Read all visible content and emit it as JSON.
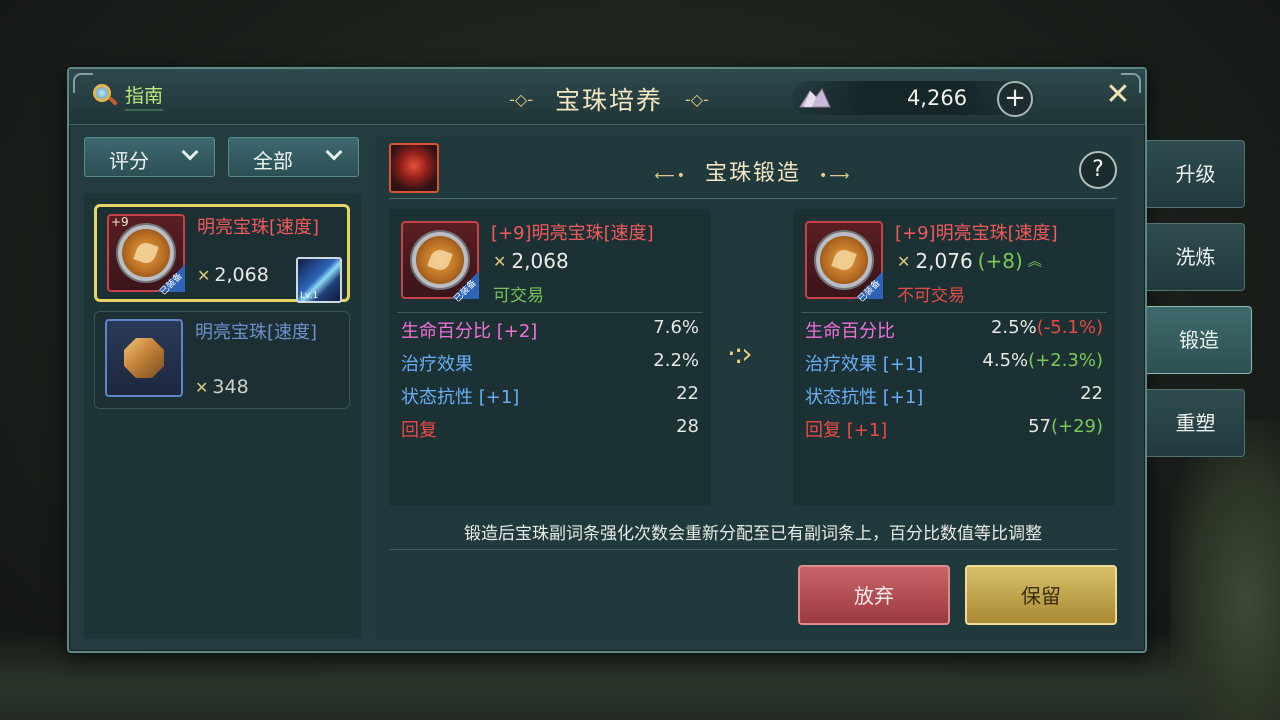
{
  "window": {
    "title": "宝珠培养",
    "guide_label": "指南"
  },
  "currency": {
    "amount": "4,266",
    "plus": "+"
  },
  "close_label": "✕",
  "filters": [
    {
      "label": "评分"
    },
    {
      "label": "全部"
    }
  ],
  "list": [
    {
      "level": "+9",
      "name": "明亮宝珠[速度]",
      "power": "2,068",
      "equip_tag": "已装备",
      "skill_lv": "Lv.1"
    },
    {
      "name": "明亮宝珠[速度]",
      "power": "348"
    }
  ],
  "forge": {
    "title": "宝珠锻造",
    "help": "?",
    "before": {
      "name": "[+9]明亮宝珠[速度]",
      "power": "2,068",
      "equip_tag": "已装备",
      "trade": "可交易",
      "stats": [
        {
          "name": "生命百分比 [+2]",
          "value": "7.6%"
        },
        {
          "name": "治疗效果",
          "value": "2.2%"
        },
        {
          "name": "状态抗性 [+1]",
          "value": "22"
        },
        {
          "name": "回复",
          "value": "28"
        }
      ]
    },
    "after": {
      "name": "[+9]明亮宝珠[速度]",
      "power": "2,076",
      "power_delta": "(+8)",
      "equip_tag": "已装备",
      "trade": "不可交易",
      "stats": [
        {
          "name": "生命百分比",
          "value": "2.5%",
          "delta": "(-5.1%)"
        },
        {
          "name": "治疗效果 [+1]",
          "value": "4.5%",
          "delta": "(+2.3%)"
        },
        {
          "name": "状态抗性 [+1]",
          "value": "22",
          "delta": ""
        },
        {
          "name": "回复 [+1]",
          "value": "57",
          "delta": "(+29)"
        }
      ]
    },
    "note": "锻造后宝珠副词条强化次数会重新分配至已有副词条上，百分比数值等比调整",
    "buttons": {
      "giveup": "放弃",
      "keep": "保留"
    }
  },
  "side_tabs": [
    "升级",
    "洗炼",
    "锻造",
    "重塑"
  ],
  "colors": {
    "accent_gold": "#e8d365",
    "rarity_red": "#f2595b",
    "rarity_blue": "#6e91cc",
    "positive": "#79c957",
    "negative": "#e84b43"
  }
}
